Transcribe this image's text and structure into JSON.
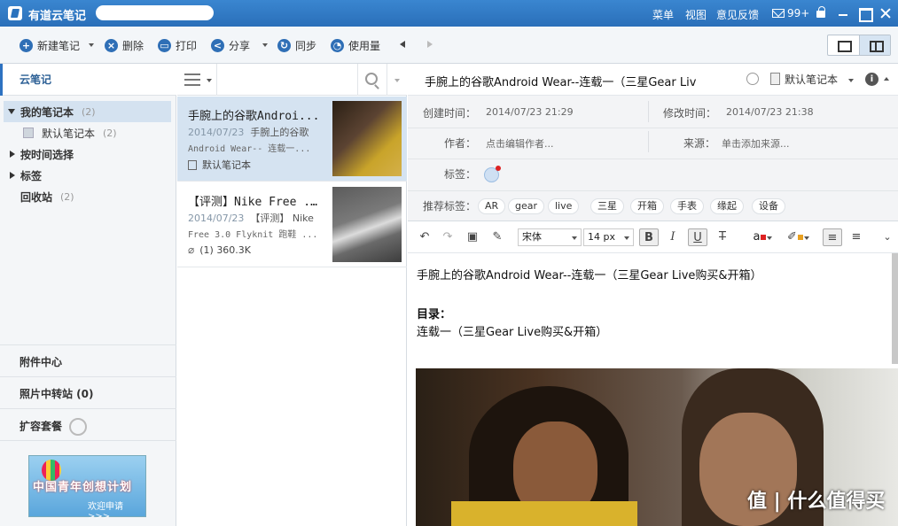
{
  "app": {
    "title": "有道云笔记"
  },
  "titlebar": {
    "menu": "菜单",
    "view": "视图",
    "feedback": "意见反馈",
    "mail_count": "99+"
  },
  "toolbar": {
    "new_note": "新建笔记",
    "delete": "删除",
    "print": "打印",
    "share": "分享",
    "sync": "同步",
    "usage": "使用量"
  },
  "sidebar": {
    "header": "云笔记",
    "my_notebooks": {
      "label": "我的笔记本",
      "count": "(2)"
    },
    "default_notebook": {
      "label": "默认笔记本",
      "count": "(2)"
    },
    "by_time": "按时间选择",
    "tags": "标签",
    "trash": {
      "label": "回收站",
      "count": "(2)"
    },
    "attachments": "附件中心",
    "photo_relay": "照片中转站 (0)",
    "expand": "扩容套餐",
    "banner": {
      "title": "中国青年创想计划",
      "sub": "欢迎申请 >>>"
    }
  },
  "notes": [
    {
      "title": "手腕上的谷歌Androi...",
      "date": "2014/07/23",
      "snippet_inline": "手腕上的谷歌",
      "snippet": "Android Wear-- 连载一...",
      "meta": "默认笔记本"
    },
    {
      "title": "【评测】Nike Free ...",
      "date": "2014/07/23",
      "snippet_inline": "【评测】 Nike",
      "snippet": "Free 3.0 Flyknit 跑鞋 ...",
      "meta": "(1) 360.3K"
    }
  ],
  "note": {
    "title": "手腕上的谷歌Android Wear--连载一（三星Gear Liv",
    "notebook": "默认笔记本",
    "created_label": "创建时间：",
    "created": "2014/07/23 21:29",
    "modified_label": "修改时间：",
    "modified": "2014/07/23 21:38",
    "author_label": "作者：",
    "author_placeholder": "点击编辑作者...",
    "source_label": "来源：",
    "source_placeholder": "单击添加来源...",
    "tags_label": "标签：",
    "suggested_label": "推荐标签：",
    "suggested_tags": [
      "AR",
      "gear",
      "live",
      "三星",
      "开箱",
      "手表",
      "缘起",
      "设备"
    ]
  },
  "editor": {
    "font": "宋体",
    "size": "14 px",
    "line1": "手腕上的谷歌Android Wear--连载一（三星Gear Live购买&开箱）",
    "toc_heading": "目录：",
    "line3": "连载一（三星Gear Live购买&开箱）"
  },
  "watermark": "值 | 什么值得买",
  "colors": {
    "accent": "#2d72c1",
    "selected": "#d5e3f1"
  }
}
